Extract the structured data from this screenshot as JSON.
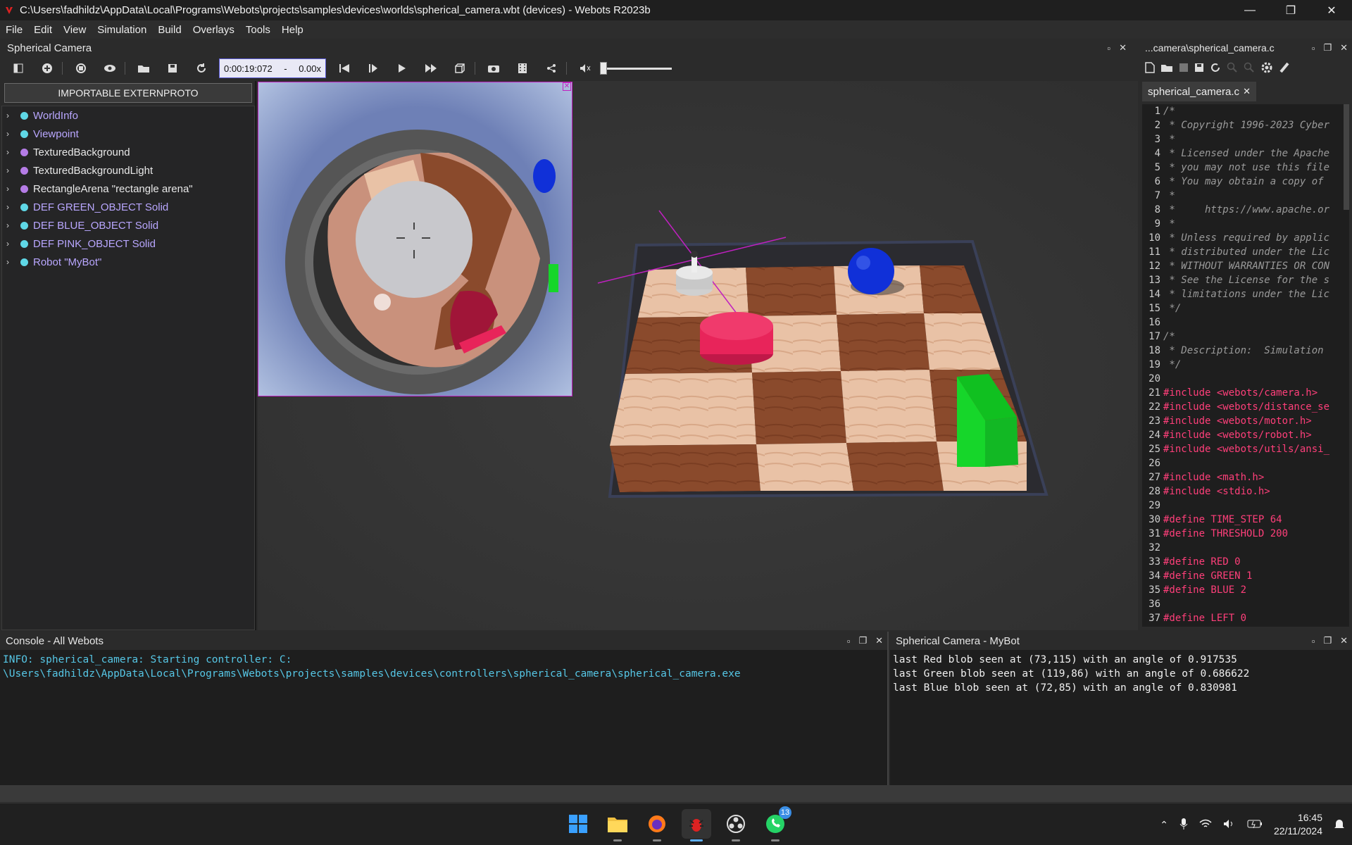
{
  "window": {
    "title": "C:\\Users\\fadhildz\\AppData\\Local\\Programs\\Webots\\projects\\samples\\devices\\worlds\\spherical_camera.wbt (devices) - Webots R2023b",
    "minimize": "—",
    "restore": "❐",
    "close": "✕"
  },
  "menu": [
    "File",
    "Edit",
    "View",
    "Simulation",
    "Build",
    "Overlays",
    "Tools",
    "Help"
  ],
  "camera_dock": {
    "title": "Spherical Camera"
  },
  "editor_dock": {
    "title": "...camera\\spherical_camera.c"
  },
  "toolbar": {
    "time": "0:00:19:072",
    "dash": "-",
    "speed": "0.00x"
  },
  "scene_tree": {
    "extern_button": "IMPORTABLE EXTERNPROTO",
    "items": [
      {
        "label": "WorldInfo",
        "color": "cyan",
        "style": "link"
      },
      {
        "label": "Viewpoint",
        "color": "cyan",
        "style": "link"
      },
      {
        "label": "TexturedBackground",
        "color": "purple",
        "style": "plain"
      },
      {
        "label": "TexturedBackgroundLight",
        "color": "purple",
        "style": "plain"
      },
      {
        "label": "RectangleArena \"rectangle arena\"",
        "color": "purple",
        "style": "plain"
      },
      {
        "label": "DEF GREEN_OBJECT Solid",
        "color": "cyan",
        "style": "link"
      },
      {
        "label": "DEF BLUE_OBJECT Solid",
        "color": "cyan",
        "style": "link"
      },
      {
        "label": "DEF PINK_OBJECT Solid",
        "color": "cyan",
        "style": "link"
      },
      {
        "label": "Robot \"MyBot\"",
        "color": "cyan",
        "style": "link"
      }
    ]
  },
  "editor": {
    "tab": "spherical_camera.c",
    "lines": [
      {
        "n": "1",
        "t": "/*",
        "k": "comment"
      },
      {
        "n": "2",
        "t": " * Copyright 1996-2023 Cyber",
        "k": "comment"
      },
      {
        "n": "3",
        "t": " *",
        "k": "comment"
      },
      {
        "n": "4",
        "t": " * Licensed under the Apache",
        "k": "comment"
      },
      {
        "n": "5",
        "t": " * you may not use this file",
        "k": "comment"
      },
      {
        "n": "6",
        "t": " * You may obtain a copy of",
        "k": "comment"
      },
      {
        "n": "7",
        "t": " *",
        "k": "comment"
      },
      {
        "n": "8",
        "t": " *     https://www.apache.or",
        "k": "comment"
      },
      {
        "n": "9",
        "t": " *",
        "k": "comment"
      },
      {
        "n": "10",
        "t": " * Unless required by applic",
        "k": "comment"
      },
      {
        "n": "11",
        "t": " * distributed under the Lic",
        "k": "comment"
      },
      {
        "n": "12",
        "t": " * WITHOUT WARRANTIES OR CON",
        "k": "comment"
      },
      {
        "n": "13",
        "t": " * See the License for the s",
        "k": "comment"
      },
      {
        "n": "14",
        "t": " * limitations under the Lic",
        "k": "comment"
      },
      {
        "n": "15",
        "t": " */",
        "k": "comment"
      },
      {
        "n": "16",
        "t": "",
        "k": "plain"
      },
      {
        "n": "17",
        "t": "/*",
        "k": "comment"
      },
      {
        "n": "18",
        "t": " * Description:  Simulation",
        "k": "comment"
      },
      {
        "n": "19",
        "t": " */",
        "k": "comment"
      },
      {
        "n": "20",
        "t": "",
        "k": "plain"
      },
      {
        "n": "21",
        "t": "#include <webots/camera.h>",
        "k": "pre"
      },
      {
        "n": "22",
        "t": "#include <webots/distance_se",
        "k": "pre"
      },
      {
        "n": "23",
        "t": "#include <webots/motor.h>",
        "k": "pre"
      },
      {
        "n": "24",
        "t": "#include <webots/robot.h>",
        "k": "pre"
      },
      {
        "n": "25",
        "t": "#include <webots/utils/ansi_",
        "k": "pre"
      },
      {
        "n": "26",
        "t": "",
        "k": "plain"
      },
      {
        "n": "27",
        "t": "#include <math.h>",
        "k": "pre"
      },
      {
        "n": "28",
        "t": "#include <stdio.h>",
        "k": "pre"
      },
      {
        "n": "29",
        "t": "",
        "k": "plain"
      },
      {
        "n": "30",
        "t": "#define TIME_STEP 64",
        "k": "pre"
      },
      {
        "n": "31",
        "t": "#define THRESHOLD 200",
        "k": "pre"
      },
      {
        "n": "32",
        "t": "",
        "k": "plain"
      },
      {
        "n": "33",
        "t": "#define RED 0",
        "k": "pre"
      },
      {
        "n": "34",
        "t": "#define GREEN 1",
        "k": "pre"
      },
      {
        "n": "35",
        "t": "#define BLUE 2",
        "k": "pre"
      },
      {
        "n": "36",
        "t": "",
        "k": "plain"
      },
      {
        "n": "37",
        "t": "#define LEFT 0",
        "k": "pre"
      }
    ]
  },
  "console": {
    "title": "Console - All Webots",
    "lines": [
      "INFO: spherical_camera: Starting controller: C:",
      "\\Users\\fadhildz\\AppData\\Local\\Programs\\Webots\\projects\\samples\\devices\\controllers\\spherical_camera\\spherical_camera.exe"
    ]
  },
  "robot_console": {
    "title": "Spherical Camera - MyBot",
    "lines": [
      "last Red blob seen at (73,115) with an angle of 0.917535",
      "last Green blob seen at (119,86) with an angle of 0.686622",
      "last Blue blob seen at (72,85) with an angle of 0.830981"
    ]
  },
  "taskbar": {
    "whatsapp_badge": "13",
    "time": "16:45",
    "date": "22/11/2024"
  },
  "colors": {
    "pink_object": "#e8245a",
    "blue_object": "#1030d8",
    "green_object": "#16d62a",
    "magenta_frame": "#c020c0"
  }
}
